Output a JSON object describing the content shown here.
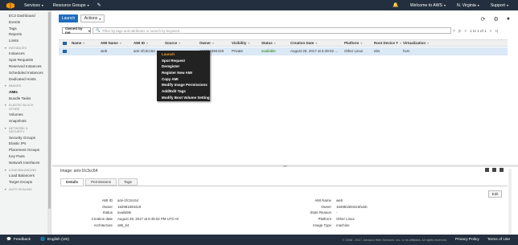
{
  "topnav": {
    "services": "Services",
    "resource_groups": "Resource Groups",
    "account": "Welcome to AWS",
    "region": "N. Virginia",
    "support": "Support"
  },
  "sidebar": {
    "items_top": [
      "EC2 Dashboard",
      "Events",
      "Tags",
      "Reports",
      "Limits"
    ],
    "sections": [
      {
        "title": "INSTANCES",
        "items": [
          "Instances",
          "Spot Requests",
          "Reserved Instances",
          "Scheduled Instances",
          "Dedicated Hosts"
        ]
      },
      {
        "title": "IMAGES",
        "items": [
          "AMIs",
          "Bundle Tasks"
        ]
      },
      {
        "title": "ELASTIC BLOCK",
        "title2": "STORE",
        "items": [
          "Volumes",
          "Snapshots"
        ]
      },
      {
        "title": "NETWORK &",
        "title2": "SECURITY",
        "items": [
          "Security Groups",
          "Elastic IPs",
          "Placement Groups",
          "Key Pairs",
          "Network Interfaces"
        ]
      },
      {
        "title": "LOAD BALANCING",
        "items": [
          "Load Balancers",
          "Target Groups"
        ]
      },
      {
        "title": "AUTO SCALING",
        "items": []
      }
    ],
    "active": "AMIs"
  },
  "toolbar": {
    "launch": "Launch",
    "actions": "Actions"
  },
  "filter": {
    "owned": "Owned by me",
    "placeholder": "Filter by tags and attributes or search by keyword",
    "pager": "1 to 1 of 1"
  },
  "table": {
    "columns": [
      "Name",
      "AMI Name",
      "AMI ID",
      "Source",
      "Owner",
      "Visibility",
      "Status",
      "Creation Date",
      "Platform",
      "Root Device T",
      "Virtualization"
    ],
    "rows": [
      {
        "name": "",
        "ami_name": "web",
        "ami_id": "ami-1fc3cc64",
        "source": "",
        "owner": "162981594419",
        "visibility": "Private",
        "status": "available",
        "creation_date": "August 29, 2017 at 6:49:02 ...",
        "platform": "Other Linux",
        "root_device": "ebs",
        "virtualization": "hvm"
      }
    ]
  },
  "context_menu": [
    "Launch",
    "Spot Request",
    "Deregister",
    "Register New AMI",
    "Copy AMI",
    "Modify Image Permissions",
    "Add/Edit Tags",
    "Modify Boot Volume Setting"
  ],
  "detail": {
    "title": "Image: ami-1fc3cc64",
    "tabs": [
      "Details",
      "Permissions",
      "Tags"
    ],
    "edit": "Edit",
    "left": [
      {
        "label": "AMI ID",
        "value": "ami-1fc3cc64"
      },
      {
        "label": "Owner",
        "value": "162981594419"
      },
      {
        "label": "Status",
        "value": "available"
      },
      {
        "label": "Creation date",
        "value": "August 29, 2017 at 6:49:02 PM UTC+8"
      },
      {
        "label": "Architecture",
        "value": "x86_64"
      }
    ],
    "right": [
      {
        "label": "AMI Name",
        "value": "web"
      },
      {
        "label": "Owner",
        "value": "162981594419/web"
      },
      {
        "label": "State Reason",
        "value": "-"
      },
      {
        "label": "Platform",
        "value": "Other Linux"
      },
      {
        "label": "Image Type",
        "value": "machine"
      }
    ]
  },
  "footer": {
    "feedback": "Feedback",
    "language": "English (US)",
    "copyright": "© 2008 - 2017, Amazon Web Services, Inc. or its affiliates. All rights reserved.",
    "privacy": "Privacy Policy",
    "terms": "Terms of Use"
  },
  "colors": {
    "nav_bg": "#232f3e",
    "primary": "#1f6ebd",
    "selected_row": "#dbe8f6",
    "available": "#1d8102",
    "menu_highlight": "#f0a030"
  }
}
